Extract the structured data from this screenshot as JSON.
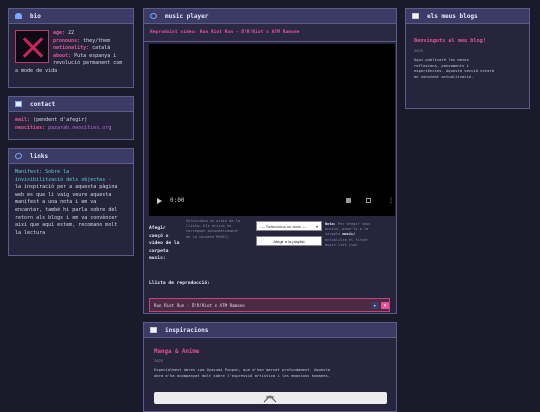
{
  "bio": {
    "title": "bio",
    "fields": [
      {
        "label": "age:",
        "value": "22"
      },
      {
        "label": "pronouns:",
        "value": "they/them"
      },
      {
        "label": "nationality:",
        "value": "català"
      },
      {
        "label": "about:",
        "value": "Puta espanya i"
      }
    ],
    "about_cont_1": "revolució permanent com",
    "about_cont_2": "a mode de vida"
  },
  "contact": {
    "title": "contact",
    "mail_label": "mail:",
    "mail_value": "(pendent d'afegir)",
    "neocities_label": "neocities:",
    "neocities_value": "pazarah.neocities.org"
  },
  "links": {
    "title": "links",
    "lines": [
      "Manifest: Sobre la",
      "invisibilització dels objectes -",
      "la inspiració per a aquesta pàgina",
      "web es que li vaig veure aquesta",
      "manifest a una nota i em va",
      "encantar, també hi parla sobre del",
      "retorn als blogs i em va convèncer",
      "així que aquí estem, recomano molt",
      "la lectura"
    ]
  },
  "music": {
    "title": "music player",
    "now_playing": "Reproduint vídeo: Run Riot Run - Ö!R!Riot x ATM Ramone",
    "time": "0:00",
    "add_label_lines": [
      "Afegir",
      "cançó o",
      "vídeo de la",
      "carpeta",
      "music:"
    ],
    "hint_lines": [
      "Selecciona un arxiu de la",
      "llista. Els arxius es",
      "carreguen automàticament",
      "de la carpeta MUSIC/"
    ],
    "select_value": "— Selecciona un arxiu —",
    "add_button": "Afegir a la playlist",
    "note_label": "Nota:",
    "note_lines": [
      "Per afegir nous",
      "arxius, posa'ls a la",
      "carpeta",
      "music/ i",
      "actualitza el fitxer",
      "music-list.json"
    ],
    "note_bold": "music/",
    "playlist_title": "Llista de reproducció:",
    "playlist": [
      {
        "title": "Run Riot Run - Ö!R!Riot x ATM Ramone"
      }
    ]
  },
  "blogs": {
    "title": "els meus blogs",
    "post_title": "Benvinguts al meu blog!",
    "post_year": "2025",
    "post_lines": [
      "Aquí publicaré les meves",
      "reflexions, pensaments i",
      "experiències. Aquesta secció estarà",
      "en constant actualització."
    ]
  },
  "inspiracions": {
    "title": "inspiracions",
    "item_title": "Manga & Anime",
    "item_year": "2025",
    "item_lines": [
      "Especialment obres com Oyasumi Punpun, que m'han marcat profundament. Aquesta",
      "obra m'ha acompanyat molt sobre l'expressió artística i les emocions humanes."
    ]
  },
  "colors": {
    "background": "#1b1a2b",
    "panel": "#26253d",
    "header": "#3c3b66",
    "accent_pink": "#e0559b",
    "accent_purple": "#b76ad9",
    "accent_cyan": "#64c7d6"
  }
}
